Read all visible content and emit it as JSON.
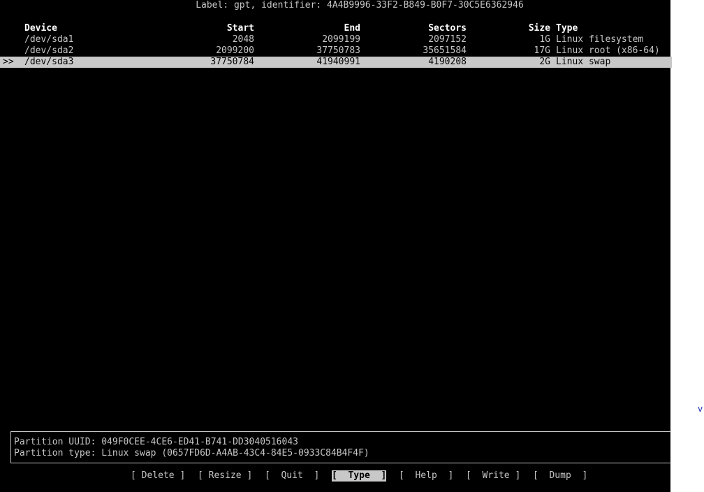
{
  "header": {
    "label_line": "Label: gpt, identifier: 4A4B9996-33F2-B849-B0F7-30C5E6362946"
  },
  "table": {
    "columns": {
      "device": "Device",
      "start": "Start",
      "end": "End",
      "sectors": "Sectors",
      "size": "Size",
      "type": "Type"
    },
    "rows": [
      {
        "marker": "",
        "device": "/dev/sda1",
        "start": "2048",
        "end": "2099199",
        "sectors": "2097152",
        "size": "1G",
        "type": "Linux filesystem"
      },
      {
        "marker": "",
        "device": "/dev/sda2",
        "start": "2099200",
        "end": "37750783",
        "sectors": "35651584",
        "size": "17G",
        "type": "Linux root (x86-64)"
      },
      {
        "marker": ">>",
        "device": "/dev/sda3",
        "start": "37750784",
        "end": "41940991",
        "sectors": "4190208",
        "size": "2G",
        "type": "Linux swap"
      }
    ],
    "selected_index": 2
  },
  "info": {
    "uuid_line": "Partition UUID: 049F0CEE-4CE6-ED41-B741-DD3040516043",
    "type_line": "Partition type: Linux swap (0657FD6D-A4AB-43C4-84E5-0933C84B4F4F)"
  },
  "menu": {
    "items": [
      {
        "label": "Delete",
        "text": "[ Delete ]"
      },
      {
        "label": "Resize",
        "text": "[ Resize ]"
      },
      {
        "label": "Quit",
        "text": "[  Quit  ]"
      },
      {
        "label": "Type",
        "text": "[  Type  ]"
      },
      {
        "label": "Help",
        "text": "[  Help  ]"
      },
      {
        "label": "Write",
        "text": "[  Write ]"
      },
      {
        "label": "Dump",
        "text": "[  Dump  ]"
      }
    ],
    "selected": "Type"
  },
  "colors": {
    "background": "#000000",
    "foreground": "#c6c6c6",
    "highlight": "#c8c8c8",
    "edge_mark": "#1a2eb8"
  }
}
